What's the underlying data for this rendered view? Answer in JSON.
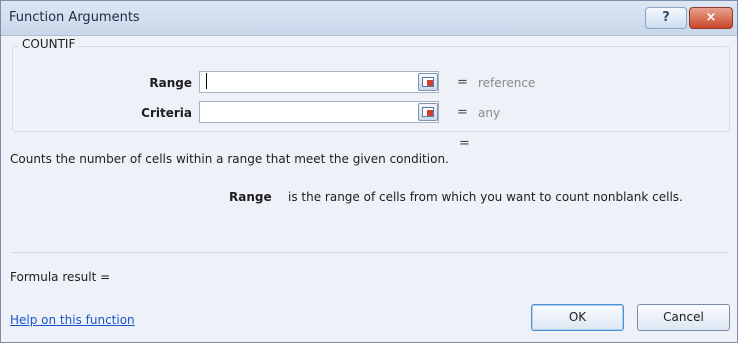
{
  "window": {
    "title": "Function Arguments",
    "help_button": "?",
    "close_button": "×"
  },
  "function": {
    "name": "COUNTIF"
  },
  "arguments": [
    {
      "label": "Range",
      "value": "",
      "equals": "=",
      "hint": "reference"
    },
    {
      "label": "Criteria",
      "value": "",
      "equals": "=",
      "hint": "any"
    }
  ],
  "overall_equals": "=",
  "description": "Counts the number of cells within a range that meet the given condition.",
  "argument_help": {
    "name": "Range",
    "text": "is the range of cells from which you want to count nonblank cells."
  },
  "formula_result_label": "Formula result =",
  "help_link": "Help on this function",
  "buttons": {
    "ok": "OK",
    "cancel": "Cancel"
  }
}
